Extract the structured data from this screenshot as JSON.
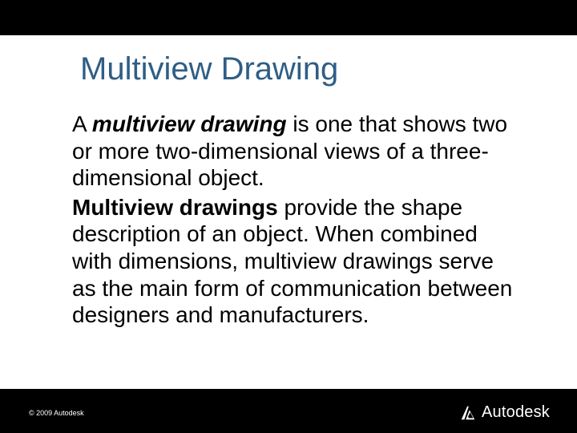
{
  "title": "Multiview Drawing",
  "paragraph1": {
    "lead_bold_italic": "multiview drawing",
    "prefix": "A ",
    "rest": " is one that shows two or more two-dimensional views of a three-dimensional object."
  },
  "paragraph2": {
    "lead_bold": "Multiview drawings",
    "rest": " provide the shape description of an object. When combined with dimensions, multiview drawings serve as the main form of communication between designers and manufacturers."
  },
  "footer": {
    "copyright": "© 2009 Autodesk",
    "logo_text": "Autodesk"
  },
  "colors": {
    "title": "#2f5e85",
    "bars": "#000000"
  }
}
